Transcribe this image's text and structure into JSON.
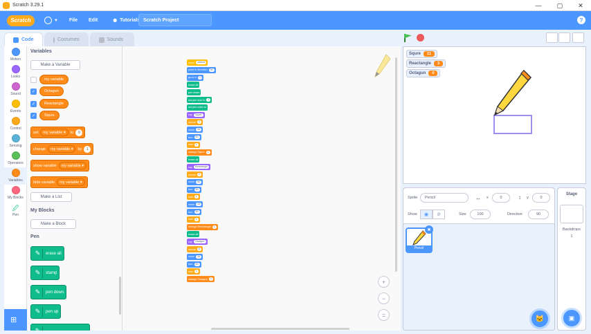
{
  "window": {
    "title": "Scratch 3.29.1",
    "controls": [
      "—",
      "▢",
      "✕"
    ]
  },
  "menubar": {
    "logo": "Scratch",
    "file": "File",
    "edit": "Edit",
    "tutorials": "Tutorials",
    "project_title": "Scratch Project",
    "help": "?"
  },
  "tabs": {
    "code": "Code",
    "costumes": "Costumes",
    "sounds": "Sounds"
  },
  "categories": [
    {
      "label": "Motion",
      "color": "#4c97ff"
    },
    {
      "label": "Looks",
      "color": "#9966ff"
    },
    {
      "label": "Sound",
      "color": "#cf63cf"
    },
    {
      "label": "Events",
      "color": "#ffbf00"
    },
    {
      "label": "Control",
      "color": "#ffab19"
    },
    {
      "label": "Sensing",
      "color": "#5cb1d6"
    },
    {
      "label": "Operators",
      "color": "#59c059"
    },
    {
      "label": "Variables",
      "color": "#ff8c1a"
    },
    {
      "label": "My Blocks",
      "color": "#ff6680"
    },
    {
      "label": "Pen",
      "color": "#0fbd8c"
    }
  ],
  "palette": {
    "variables_heading": "Variables",
    "make_variable": "Make a Variable",
    "variables": [
      "my variable",
      "Octagun",
      "Reactangle",
      "Squre"
    ],
    "set": {
      "label": "set",
      "var": "my variable",
      "to": "to",
      "value": "0"
    },
    "change": {
      "label": "change",
      "var": "my variable",
      "by": "by",
      "value": "1"
    },
    "show": {
      "label": "show variable",
      "var": "my variable"
    },
    "hide": {
      "label": "hide variable",
      "var": "my variable"
    },
    "make_list": "Make a List",
    "myblocks_heading": "My Blocks",
    "make_block": "Make a Block",
    "pen_heading": "Pen",
    "pen_blocks": [
      "erase all",
      "stamp",
      "pen down",
      "pen up"
    ]
  },
  "script": [
    {
      "c": "c-ev",
      "t": "when",
      "v": "clicked"
    },
    {
      "c": "c-mo",
      "t": "point in direction",
      "v": "90"
    },
    {
      "c": "c-mo",
      "t": "go to x:",
      "v": "0"
    },
    {
      "c": "c-pen",
      "t": "erase all",
      "v": ""
    },
    {
      "c": "c-pen",
      "t": "pen down",
      "v": ""
    },
    {
      "c": "c-pen",
      "t": "set pen size to",
      "v": "1"
    },
    {
      "c": "c-pen",
      "t": "set pen color to",
      "v": ""
    },
    {
      "c": "c-lk",
      "t": "say",
      "v": "Squre"
    },
    {
      "c": "c-ct",
      "t": "repeat",
      "v": "4"
    },
    {
      "c": "c-mo",
      "t": "move",
      "v": "50"
    },
    {
      "c": "c-mo",
      "t": "turn",
      "v": "90"
    },
    {
      "c": "c-ct",
      "t": "wait",
      "v": "1"
    },
    {
      "c": "c-var",
      "t": "change Squre",
      "v": "1"
    },
    {
      "c": "c-pen",
      "t": "erase all",
      "v": ""
    },
    {
      "c": "c-lk",
      "t": "say",
      "v": "Reactangle"
    },
    {
      "c": "c-ct",
      "t": "repeat",
      "v": "2"
    },
    {
      "c": "c-mo",
      "t": "move",
      "v": "50"
    },
    {
      "c": "c-mo",
      "t": "turn",
      "v": "90"
    },
    {
      "c": "c-ct",
      "t": "wait",
      "v": "1"
    },
    {
      "c": "c-mo",
      "t": "move",
      "v": "25"
    },
    {
      "c": "c-mo",
      "t": "turn",
      "v": "90"
    },
    {
      "c": "c-ct",
      "t": "wait",
      "v": "1"
    },
    {
      "c": "c-var",
      "t": "change Reactangle",
      "v": "1"
    },
    {
      "c": "c-pen",
      "t": "erase all",
      "v": ""
    },
    {
      "c": "c-lk",
      "t": "say",
      "v": "Octagun"
    },
    {
      "c": "c-ct",
      "t": "repeat",
      "v": "8"
    },
    {
      "c": "c-mo",
      "t": "move",
      "v": "30"
    },
    {
      "c": "c-mo",
      "t": "turn",
      "v": "45"
    },
    {
      "c": "c-ct",
      "t": "wait",
      "v": "1"
    },
    {
      "c": "c-var",
      "t": "change Octagun",
      "v": "1"
    }
  ],
  "zoom": {
    "in": "+",
    "out": "−",
    "reset": "="
  },
  "monitors": [
    {
      "name": "Squre",
      "value": "11"
    },
    {
      "name": "Reactangle",
      "value": "3"
    },
    {
      "name": "Octagun",
      "value": "0"
    }
  ],
  "sprite_info": {
    "sprite_label": "Sprite",
    "sprite_name": "Pencil",
    "x_label": "x",
    "x_value": "0",
    "y_label": "y",
    "y_value": "0",
    "show_label": "Show",
    "size_label": "Size",
    "size_value": "100",
    "direction_label": "Direction",
    "direction_value": "90"
  },
  "sprite_thumb": {
    "label": "Pencil"
  },
  "stage_panel": {
    "title": "Stage",
    "backdrops_label": "Backdrops",
    "backdrops_count": "1"
  }
}
